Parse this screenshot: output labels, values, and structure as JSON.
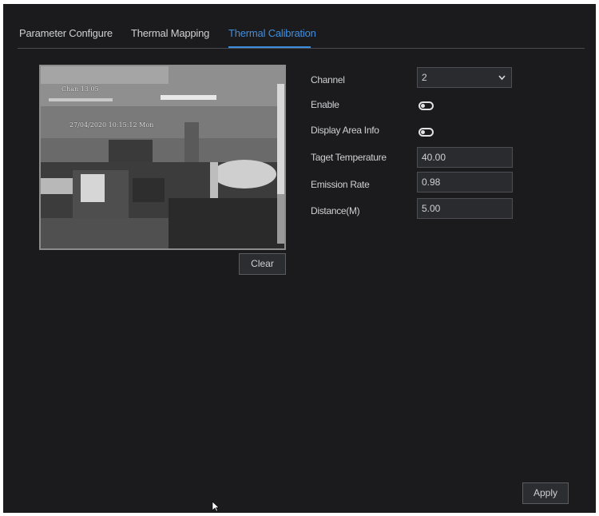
{
  "tabs": [
    {
      "label": "Parameter Configure",
      "active": false
    },
    {
      "label": "Thermal Mapping",
      "active": false
    },
    {
      "label": "Thermal Calibration",
      "active": true
    }
  ],
  "preview": {
    "osd_channel": "Chan 13 05",
    "osd_timestamp": "27/04/2020 10:15:12 Mon"
  },
  "clear_label": "Clear",
  "form": {
    "channel_label": "Channel",
    "channel_value": "2",
    "enable_label": "Enable",
    "display_area_info_label": "Display Area Info",
    "target_temperature_label": "Taget Temperature",
    "target_temperature_value": "40.00",
    "emission_rate_label": "Emission Rate",
    "emission_rate_value": "0.98",
    "distance_label": "Distance(M)",
    "distance_value": "5.00"
  },
  "apply_label": "Apply",
  "colors": {
    "accent": "#3f8fe0",
    "background": "#1b1b1e"
  },
  "icons": {
    "dropdown": "chevron-down-icon",
    "toggle": "toggle-off-icon",
    "cursor": "mouse-pointer-icon"
  }
}
